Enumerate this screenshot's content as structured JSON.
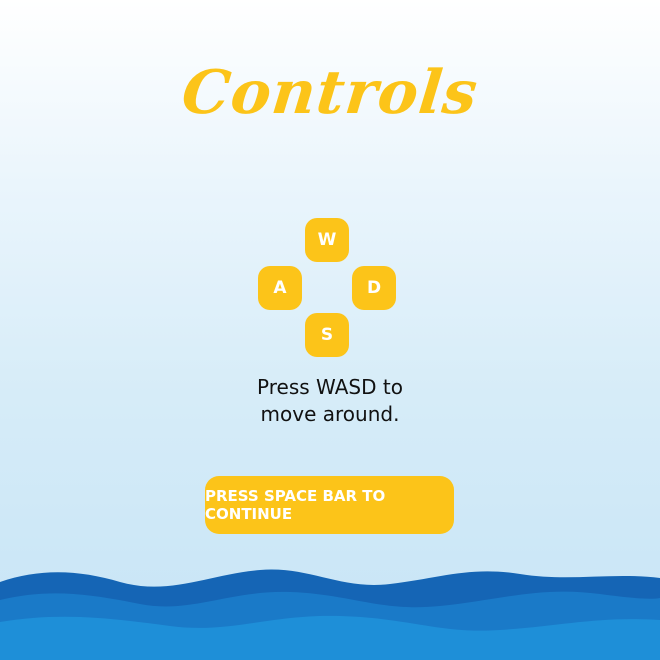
{
  "title": "Controls",
  "keys": {
    "up": "W",
    "left": "A",
    "right": "D",
    "down": "S"
  },
  "instructions": {
    "line1": "Press WASD to",
    "line2": "move around."
  },
  "continue_button": {
    "label": "PRESS SPACE BAR TO CONTINUE"
  },
  "colors": {
    "accent": "#fcc419",
    "key_text": "#ffffff",
    "body_text": "#111111",
    "wave_dark": "#1565b5",
    "wave_mid": "#1a7ac8",
    "wave_light": "#1e8fd8"
  }
}
